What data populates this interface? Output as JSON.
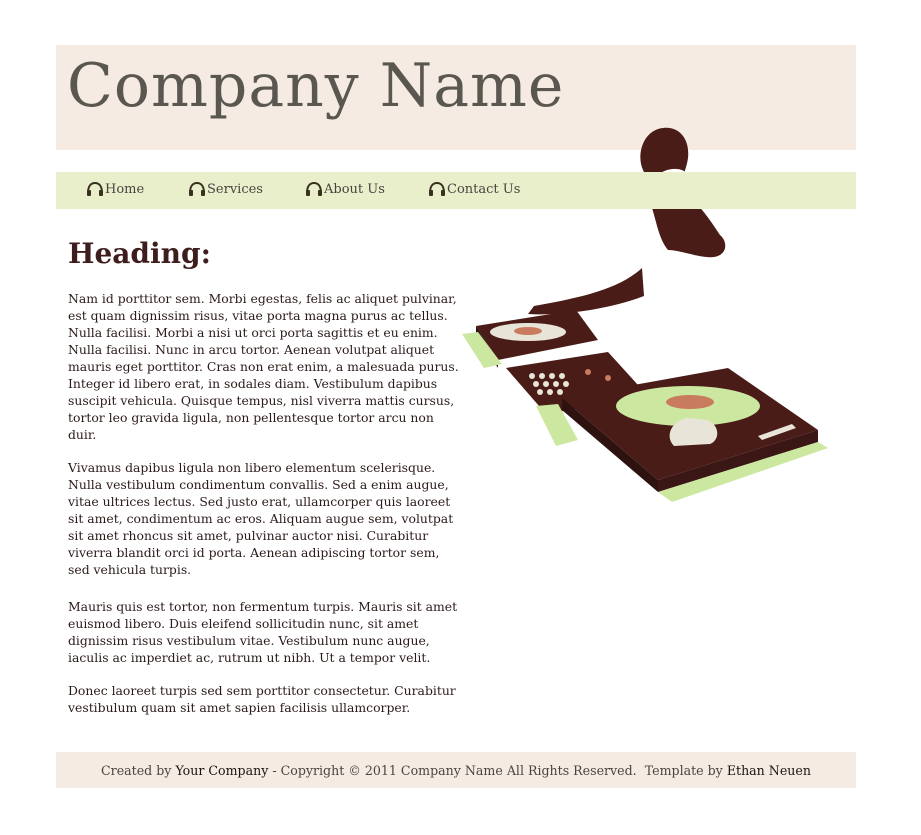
{
  "header": {
    "company_name": "Company Name"
  },
  "nav": {
    "items": [
      {
        "label": "Home"
      },
      {
        "label": "Services"
      },
      {
        "label": "About Us"
      },
      {
        "label": "Contact Us"
      }
    ]
  },
  "main": {
    "heading": "Heading:",
    "paragraphs": [
      "Nam id porttitor sem. Morbi egestas, felis ac aliquet pulvinar, est quam dignissim risus, vitae porta magna purus ac tellus. Nulla facilisi. Morbi a nisi ut orci porta sagittis et eu enim. Nulla facilisi. Nunc in arcu tortor. Aenean volutpat aliquet mauris eget porttitor. Cras non erat enim, a malesuada purus. Integer id libero erat, in sodales diam. Vestibulum dapibus suscipit vehicula. Quisque tempus, nisl viverra mattis cursus, tortor leo gravida ligula, non pellentesque tortor arcu non duir.",
      "Vivamus dapibus ligula non libero elementum scelerisque. Nulla vestibulum condimentum convallis. Sed a enim augue, vitae ultrices lectus. Sed justo erat, ullamcorper quis laoreet sit amet, condimentum ac eros. Aliquam augue sem, volutpat sit amet rhoncus sit amet, pulvinar auctor nisi. Curabitur viverra blandit orci id porta. Aenean adipiscing tortor sem, sed vehicula turpis.",
      "Mauris quis est tortor, non fermentum turpis. Mauris sit amet euismod libero. Duis eleifend sollicitudin nunc, sit amet dignissim risus vestibulum vitae. Vestibulum nunc augue, iaculis ac imperdiet ac, rutrum ut nibh. Ut a tempor velit.",
      "Donec laoreet turpis sed sem porttitor consectetur. Curabitur vestibulum quam sit amet sapien facilisis ullamcorper."
    ]
  },
  "footer": {
    "created_by": "Created by ",
    "your_company": "Your Company",
    "copyright": " - Copyright © 2011 Company Name All Rights Reserved.  Template by ",
    "author": "Ethan Neuen"
  },
  "colors": {
    "header_bg": "#f5ebe2",
    "nav_bg": "#e9efcb",
    "heading": "#3e1e1c",
    "dj_brown": "#4a1c17",
    "dj_green": "#cce8a0"
  },
  "icons": {
    "nav_icon": "headphones-icon",
    "illustration": "dj-turntables-illustration"
  }
}
